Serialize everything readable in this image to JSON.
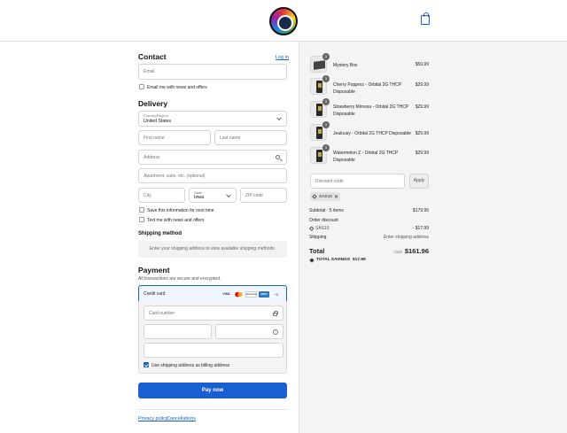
{
  "header": {
    "logo_icon": "brand-logo",
    "cart_icon": "shopping-bag-icon"
  },
  "contact": {
    "title": "Contact",
    "login_link": "Log in",
    "email_placeholder": "Email",
    "news_label": "Email me with news and offers"
  },
  "delivery": {
    "title": "Delivery",
    "country_label": "Country/Region",
    "country_value": "United States",
    "first_name": "First name",
    "last_name": "Last name",
    "address": "Address",
    "apartment": "Apartment, suite, etc. (optional)",
    "city": "City",
    "state_label": "State",
    "state_value": "Iowa",
    "zip": "ZIP code",
    "save_info_label": "Save this information for next time",
    "text_news_label": "Text me with news and offers"
  },
  "shipping": {
    "title": "Shipping method",
    "message": "Enter your shipping address to view available shipping methods."
  },
  "payment": {
    "title": "Payment",
    "subtitle": "All transactions are secure and encrypted.",
    "method_label": "Credit card",
    "card_brands": [
      "VISA",
      "MC",
      "DISCOVER",
      "AMEX",
      "+5"
    ],
    "card_number": "Card number",
    "billing_label": "Use shipping address as billing address",
    "pay_button": "Pay now"
  },
  "footer": {
    "privacy": "Privacy policy",
    "cancellations": "Cancellations"
  },
  "order": {
    "items": [
      {
        "name": "Mystery Box",
        "qty": "1",
        "price": "$59.99",
        "image": "mystery-box"
      },
      {
        "name": "Cherry Popperz - Orbital 2G THCP Disposable",
        "qty": "1",
        "price": "$29.99",
        "image": "vape-product"
      },
      {
        "name": "Strawberry Mimosa - Orbital 2G THCP Disposable",
        "qty": "1",
        "price": "$29.99",
        "image": "vape-product"
      },
      {
        "name": "Jealousy - Orbital 2G THCP Disposable",
        "qty": "1",
        "price": "$29.99",
        "image": "vape-product"
      },
      {
        "name": "Watermelon Z - Orbital 2G THCP Disposable",
        "qty": "1",
        "price": "$29.99",
        "image": "vape-product"
      }
    ],
    "discount_placeholder": "Discount code",
    "apply_label": "Apply",
    "applied_code": "SAS10",
    "subtotal_label": "Subtotal · 5 items",
    "subtotal_value": "$179.95",
    "order_discount_label": "Order discount",
    "discount_code": "SAS10",
    "discount_value": "- $17.99",
    "shipping_label": "Shipping",
    "shipping_value": "Enter shipping address",
    "total_label": "Total",
    "currency": "USD",
    "total_value": "$161.96",
    "savings_label": "TOTAL SAVINGS",
    "savings_value": "$17.99"
  }
}
